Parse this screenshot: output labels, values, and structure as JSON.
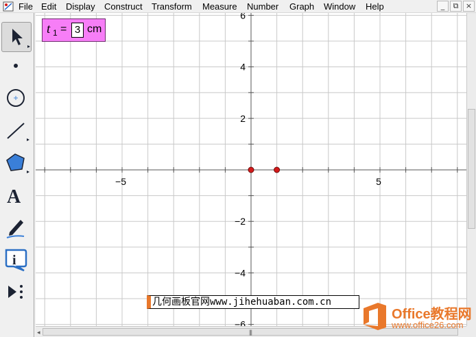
{
  "menu": {
    "items": [
      "File",
      "Edit",
      "Display",
      "Construct",
      "Transform",
      "Measure",
      "Number",
      "Graph",
      "Window",
      "Help"
    ],
    "window_buttons": [
      "_",
      "⧉",
      "×"
    ]
  },
  "toolbox": {
    "tools": [
      "Arrow",
      "Point",
      "Compass",
      "Straightedge",
      "Polygon",
      "Text",
      "Marker",
      "Information",
      "Custom"
    ],
    "selected": "Arrow"
  },
  "parameter": {
    "name": "t",
    "subscript": "1",
    "equals": "=",
    "value": "3",
    "unit": "cm"
  },
  "axes": {
    "x_tick_labels": [
      "−5",
      "5"
    ],
    "y_tick_labels": [
      "6",
      "4",
      "2",
      "−2",
      "−4",
      "−6"
    ],
    "grid": true
  },
  "points": [
    {
      "x": 0,
      "y": 0
    },
    {
      "x": 1,
      "y": 0
    }
  ],
  "colors": {
    "grid": "#c8c8c8",
    "axis": "#555555",
    "point": "#d41a1a",
    "parameter_bg": "#f77ef7",
    "logo": "#e9782b"
  },
  "watermark_text": "几何画板官网www.jihehuaban.com.cn",
  "logo": {
    "title": "Office教程网",
    "url": "www.office26.com"
  }
}
